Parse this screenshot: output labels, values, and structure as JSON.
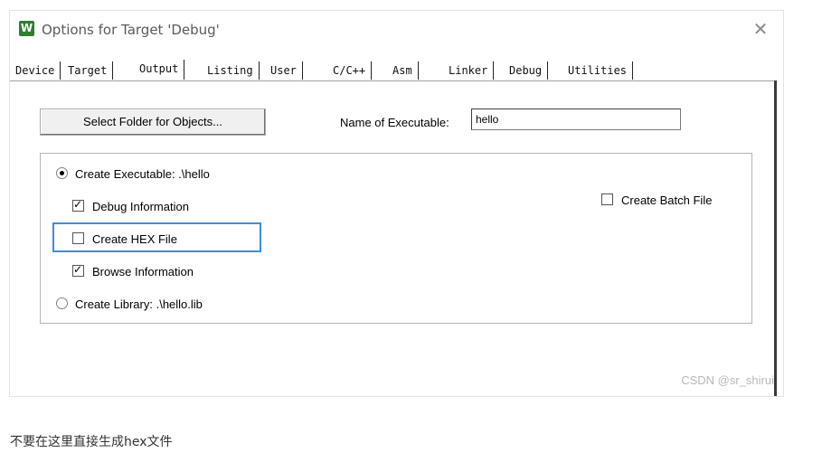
{
  "window": {
    "title": "Options for Target 'Debug'",
    "app_icon_glyph": "W",
    "close_glyph": "✕"
  },
  "tabs": [
    {
      "label": "Device",
      "active": false
    },
    {
      "label": "Target",
      "active": false
    },
    {
      "label": "Output",
      "active": true
    },
    {
      "label": "Listing",
      "active": false
    },
    {
      "label": "User",
      "active": false
    },
    {
      "label": "C/C++",
      "active": false
    },
    {
      "label": "Asm",
      "active": false
    },
    {
      "label": "Linker",
      "active": false
    },
    {
      "label": "Debug",
      "active": false
    },
    {
      "label": "Utilities",
      "active": false
    }
  ],
  "output": {
    "select_folder_label": "Select Folder for Objects...",
    "name_of_executable_label": "Name of Executable:",
    "name_of_executable_value": "hello",
    "create_executable_label": "Create Executable:  .\\hello",
    "create_executable_selected": true,
    "debug_information_label": "Debug Information",
    "debug_information_checked": true,
    "create_hex_label": "Create HEX File",
    "create_hex_checked": false,
    "browse_information_label": "Browse Information",
    "browse_information_checked": true,
    "create_library_label": "Create Library:  .\\hello.lib",
    "create_library_selected": false,
    "create_batch_label": "Create Batch File",
    "create_batch_checked": false
  },
  "watermark": "CSDN @sr_shirui",
  "caption": "不要在这里直接生成hex文件",
  "colors": {
    "highlight": "#3b8fd9",
    "app_icon": "#2f7d32"
  }
}
